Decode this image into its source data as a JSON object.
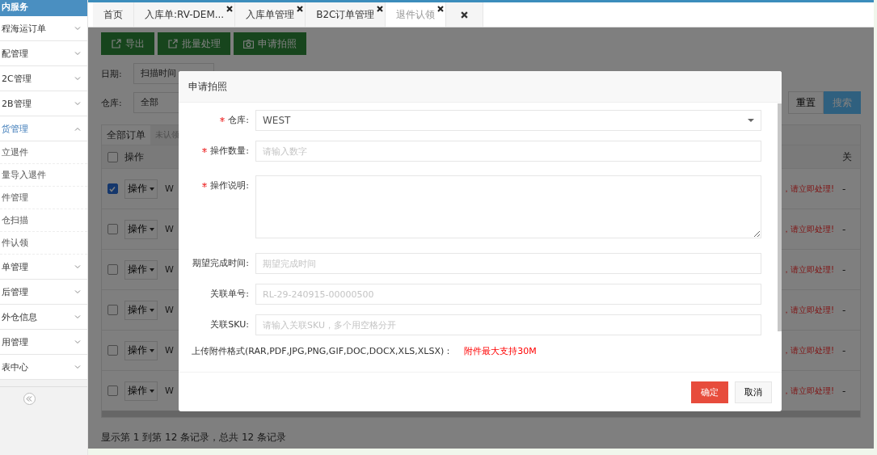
{
  "sidebar": {
    "header": "内服务",
    "groups": [
      {
        "label": "程海运订单",
        "expanded": false
      },
      {
        "label": "配管理",
        "expanded": false
      },
      {
        "label": "2C管理",
        "expanded": false
      },
      {
        "label": "2B管理",
        "expanded": false
      },
      {
        "label": "货管理",
        "expanded": true,
        "children": [
          {
            "label": "立退件"
          },
          {
            "label": "量导入退件"
          },
          {
            "label": "件管理"
          },
          {
            "label": "仓扫描"
          },
          {
            "label": "件认领"
          }
        ]
      },
      {
        "label": "单管理",
        "expanded": false
      },
      {
        "label": "后管理",
        "expanded": false
      },
      {
        "label": "外仓信息",
        "expanded": false
      },
      {
        "label": "用管理",
        "expanded": false
      },
      {
        "label": "表中心",
        "expanded": false
      }
    ]
  },
  "tabs": [
    {
      "label": "首页",
      "selected": false,
      "closable": false
    },
    {
      "label": "入库单:RV-DEM...",
      "selected": false,
      "closable": true
    },
    {
      "label": "入库单管理",
      "selected": false,
      "closable": true
    },
    {
      "label": "B2C订单管理",
      "selected": false,
      "closable": true
    },
    {
      "label": "退件认领",
      "selected": true,
      "closable": true
    }
  ],
  "toolbar": [
    "导出",
    "批量处理",
    "申请拍照"
  ],
  "filters": {
    "date_label": "日期:",
    "date_type": "扫描时间",
    "warehouse_label": "仓库:",
    "warehouse": "全部",
    "reset": "重置",
    "search": "搜索"
  },
  "subtabs": [
    {
      "label": "全部订单",
      "selected": true
    },
    {
      "label": "未认领",
      "selected": false
    }
  ],
  "table": {
    "header_checked": false,
    "columns": [
      "操作",
      "关"
    ],
    "rows": [
      {
        "checked": true,
        "action": "操作",
        "column_3": "W",
        "notice": "，请立即处理!",
        "column_5": "-"
      },
      {
        "checked": false,
        "action": "操作",
        "column_3": "W",
        "notice": "，请立即处理!",
        "column_5": "-"
      },
      {
        "checked": false,
        "action": "操作",
        "column_3": "W",
        "notice": "，请立即处理!",
        "column_5": "-"
      },
      {
        "checked": false,
        "action": "操作",
        "column_3": "W",
        "notice": "，请立即处理!",
        "column_5": "-"
      },
      {
        "checked": false,
        "action": "操作",
        "column_3": "W",
        "notice": "，请立即处理!",
        "column_5": "-"
      },
      {
        "checked": false,
        "action": "操作",
        "column_3": "W",
        "notice": "，请立即处理!",
        "column_5": "-"
      }
    ]
  },
  "pagination": "显示第 1 到第 12 条记录，总共 12 条记录",
  "dialog": {
    "title": "申请拍照",
    "fields": [
      {
        "kind": "select",
        "label": "仓库:",
        "required": true,
        "value": "WEST"
      },
      {
        "kind": "input",
        "label": "操作数量:",
        "required": true,
        "placeholder": "请输入数字"
      },
      {
        "kind": "textarea",
        "label": "操作说明:",
        "required": true
      },
      {
        "kind": "input",
        "label": "期望完成时间:",
        "required": false,
        "placeholder": "期望完成时间"
      },
      {
        "kind": "input",
        "label": "关联单号:",
        "required": false,
        "placeholder": "RL-29-240915-00000500"
      },
      {
        "kind": "input",
        "label": "关联SKU:",
        "required": false,
        "placeholder": "请输入关联SKU，多个用空格分开"
      }
    ],
    "upload_label": "上传附件格式(RAR,PDF,JPG,PNG,GIF,DOC,DOCX,XLS,XLSX)：",
    "upload_limit": "附件最大支持30M",
    "confirm": "确定",
    "cancel": "取消"
  }
}
